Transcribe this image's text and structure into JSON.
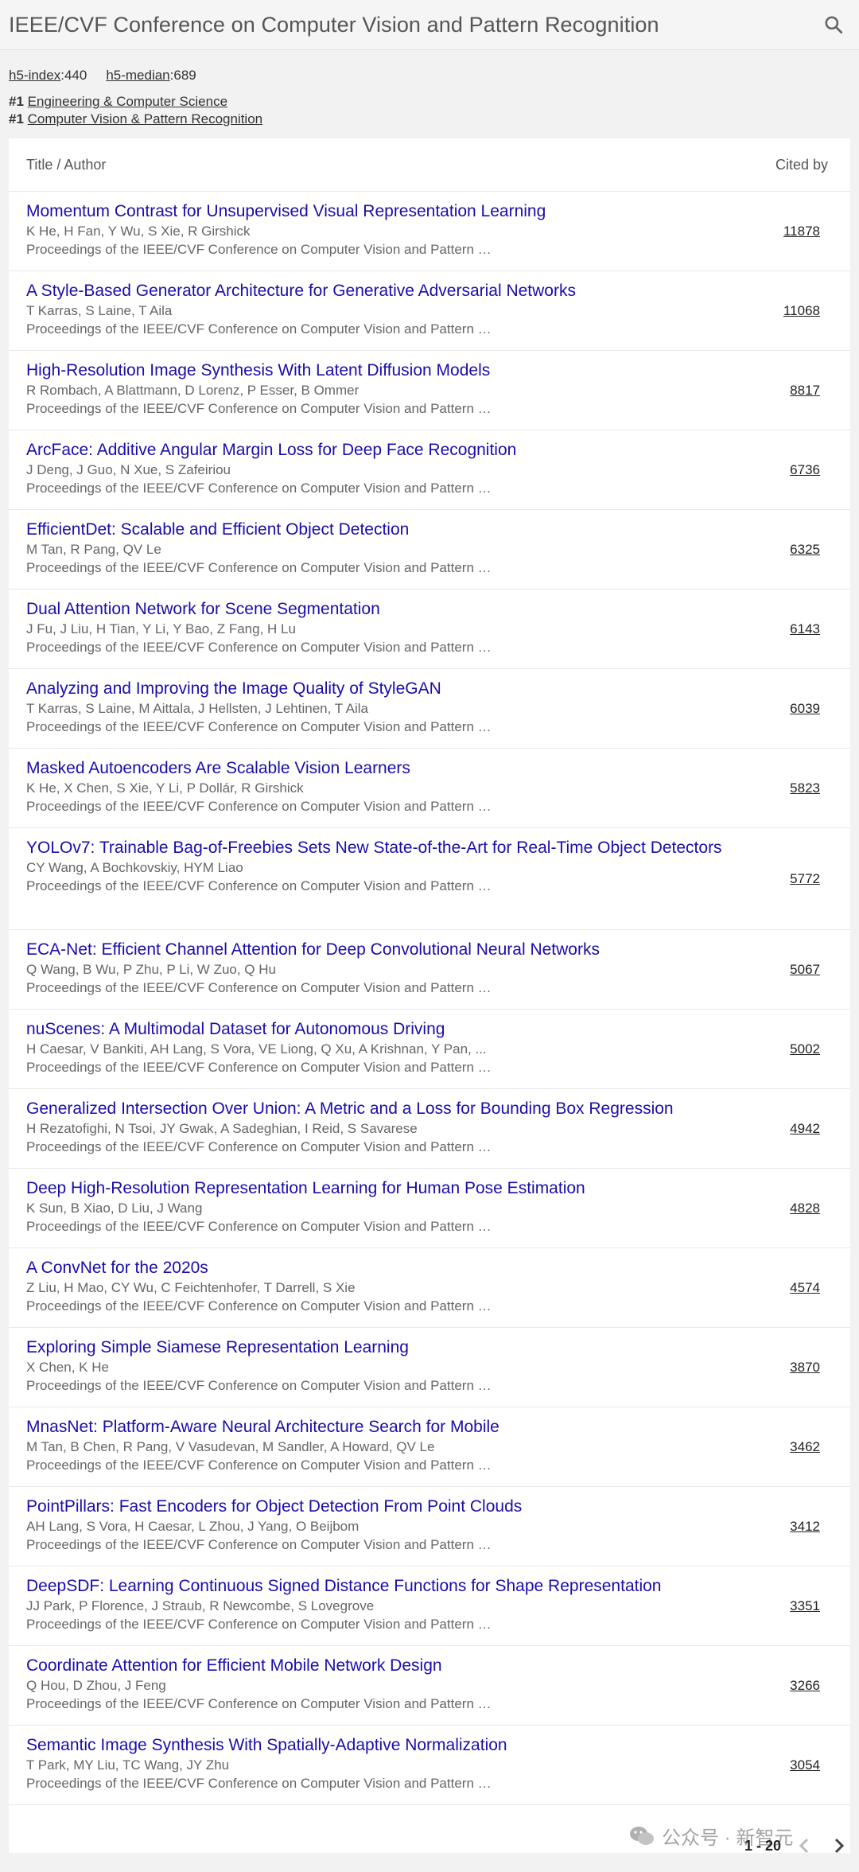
{
  "header": {
    "title": "IEEE/CVF Conference on Computer Vision and Pattern Recognition",
    "search_icon": "search-icon"
  },
  "metrics": {
    "h5_index_label": "h5-index",
    "h5_index_value": ":440",
    "h5_median_label": "h5-median",
    "h5_median_value": ":689"
  },
  "rankings": [
    {
      "num": "#1",
      "category": "Engineering & Computer Science"
    },
    {
      "num": "#1",
      "category": "Computer Vision & Pattern Recognition"
    }
  ],
  "table": {
    "col_title": "Title / Author",
    "col_cited": "Cited by",
    "rows": [
      {
        "title": "Momentum Contrast for Unsupervised Visual Representation Learning",
        "authors": "K He, H Fan, Y Wu, S Xie, R Girshick",
        "venue": "Proceedings of the IEEE/CVF Conference on Computer Vision and Pattern …",
        "cited": "11878"
      },
      {
        "title": "A Style-Based Generator Architecture for Generative Adversarial Networks",
        "authors": "T Karras, S Laine, T Aila",
        "venue": "Proceedings of the IEEE/CVF Conference on Computer Vision and Pattern …",
        "cited": "11068"
      },
      {
        "title": "High-Resolution Image Synthesis With Latent Diffusion Models",
        "authors": "R Rombach, A Blattmann, D Lorenz, P Esser, B Ommer",
        "venue": "Proceedings of the IEEE/CVF Conference on Computer Vision and Pattern …",
        "cited": "8817"
      },
      {
        "title": "ArcFace: Additive Angular Margin Loss for Deep Face Recognition",
        "authors": "J Deng, J Guo, N Xue, S Zafeiriou",
        "venue": "Proceedings of the IEEE/CVF Conference on Computer Vision and Pattern …",
        "cited": "6736"
      },
      {
        "title": "EfficientDet: Scalable and Efficient Object Detection",
        "authors": "M Tan, R Pang, QV Le",
        "venue": "Proceedings of the IEEE/CVF Conference on Computer Vision and Pattern …",
        "cited": "6325"
      },
      {
        "title": "Dual Attention Network for Scene Segmentation",
        "authors": "J Fu, J Liu, H Tian, Y Li, Y Bao, Z Fang, H Lu",
        "venue": "Proceedings of the IEEE/CVF Conference on Computer Vision and Pattern …",
        "cited": "6143"
      },
      {
        "title": "Analyzing and Improving the Image Quality of StyleGAN",
        "authors": "T Karras, S Laine, M Aittala, J Hellsten, J Lehtinen, T Aila",
        "venue": "Proceedings of the IEEE/CVF Conference on Computer Vision and Pattern …",
        "cited": "6039"
      },
      {
        "title": "Masked Autoencoders Are Scalable Vision Learners",
        "authors": "K He, X Chen, S Xie, Y Li, P Dollár, R Girshick",
        "venue": "Proceedings of the IEEE/CVF Conference on Computer Vision and Pattern …",
        "cited": "5823"
      },
      {
        "title": "YOLOv7: Trainable Bag-of-Freebies Sets New State-of-the-Art for Real-Time Object Detectors",
        "authors": "CY Wang, A Bochkovskiy, HYM Liao",
        "venue": "Proceedings of the IEEE/CVF Conference on Computer Vision and Pattern …",
        "cited": "5772"
      },
      {
        "title": "ECA-Net: Efficient Channel Attention for Deep Convolutional Neural Networks",
        "authors": "Q Wang, B Wu, P Zhu, P Li, W Zuo, Q Hu",
        "venue": "Proceedings of the IEEE/CVF Conference on Computer Vision and Pattern …",
        "cited": "5067"
      },
      {
        "title": "nuScenes: A Multimodal Dataset for Autonomous Driving",
        "authors": "H Caesar, V Bankiti, AH Lang, S Vora, VE Liong, Q Xu, A Krishnan, Y Pan, ...",
        "venue": "Proceedings of the IEEE/CVF Conference on Computer Vision and Pattern …",
        "cited": "5002"
      },
      {
        "title": "Generalized Intersection Over Union: A Metric and a Loss for Bounding Box Regression",
        "authors": "H Rezatofighi, N Tsoi, JY Gwak, A Sadeghian, I Reid, S Savarese",
        "venue": "Proceedings of the IEEE/CVF Conference on Computer Vision and Pattern …",
        "cited": "4942"
      },
      {
        "title": "Deep High-Resolution Representation Learning for Human Pose Estimation",
        "authors": "K Sun, B Xiao, D Liu, J Wang",
        "venue": "Proceedings of the IEEE/CVF Conference on Computer Vision and Pattern …",
        "cited": "4828"
      },
      {
        "title": "A ConvNet for the 2020s",
        "authors": "Z Liu, H Mao, CY Wu, C Feichtenhofer, T Darrell, S Xie",
        "venue": "Proceedings of the IEEE/CVF Conference on Computer Vision and Pattern …",
        "cited": "4574"
      },
      {
        "title": "Exploring Simple Siamese Representation Learning",
        "authors": "X Chen, K He",
        "venue": "Proceedings of the IEEE/CVF Conference on Computer Vision and Pattern …",
        "cited": "3870"
      },
      {
        "title": "MnasNet: Platform-Aware Neural Architecture Search for Mobile",
        "authors": "M Tan, B Chen, R Pang, V Vasudevan, M Sandler, A Howard, QV Le",
        "venue": "Proceedings of the IEEE/CVF Conference on Computer Vision and Pattern …",
        "cited": "3462"
      },
      {
        "title": "PointPillars: Fast Encoders for Object Detection From Point Clouds",
        "authors": "AH Lang, S Vora, H Caesar, L Zhou, J Yang, O Beijbom",
        "venue": "Proceedings of the IEEE/CVF Conference on Computer Vision and Pattern …",
        "cited": "3412"
      },
      {
        "title": "DeepSDF: Learning Continuous Signed Distance Functions for Shape Representation",
        "authors": "JJ Park, P Florence, J Straub, R Newcombe, S Lovegrove",
        "venue": "Proceedings of the IEEE/CVF Conference on Computer Vision and Pattern …",
        "cited": "3351"
      },
      {
        "title": "Coordinate Attention for Efficient Mobile Network Design",
        "authors": "Q Hou, D Zhou, J Feng",
        "venue": "Proceedings of the IEEE/CVF Conference on Computer Vision and Pattern …",
        "cited": "3266"
      },
      {
        "title": "Semantic Image Synthesis With Spatially-Adaptive Normalization",
        "authors": "T Park, MY Liu, TC Wang, JY Zhu",
        "venue": "Proceedings of the IEEE/CVF Conference on Computer Vision and Pattern …",
        "cited": "3054"
      }
    ]
  },
  "pagination": {
    "range": "1 - 20",
    "prev_icon": "chevron-left-icon",
    "next_icon": "chevron-right-icon"
  },
  "watermark": {
    "text": "公众号 · 新智元",
    "icon": "wechat-icon"
  }
}
